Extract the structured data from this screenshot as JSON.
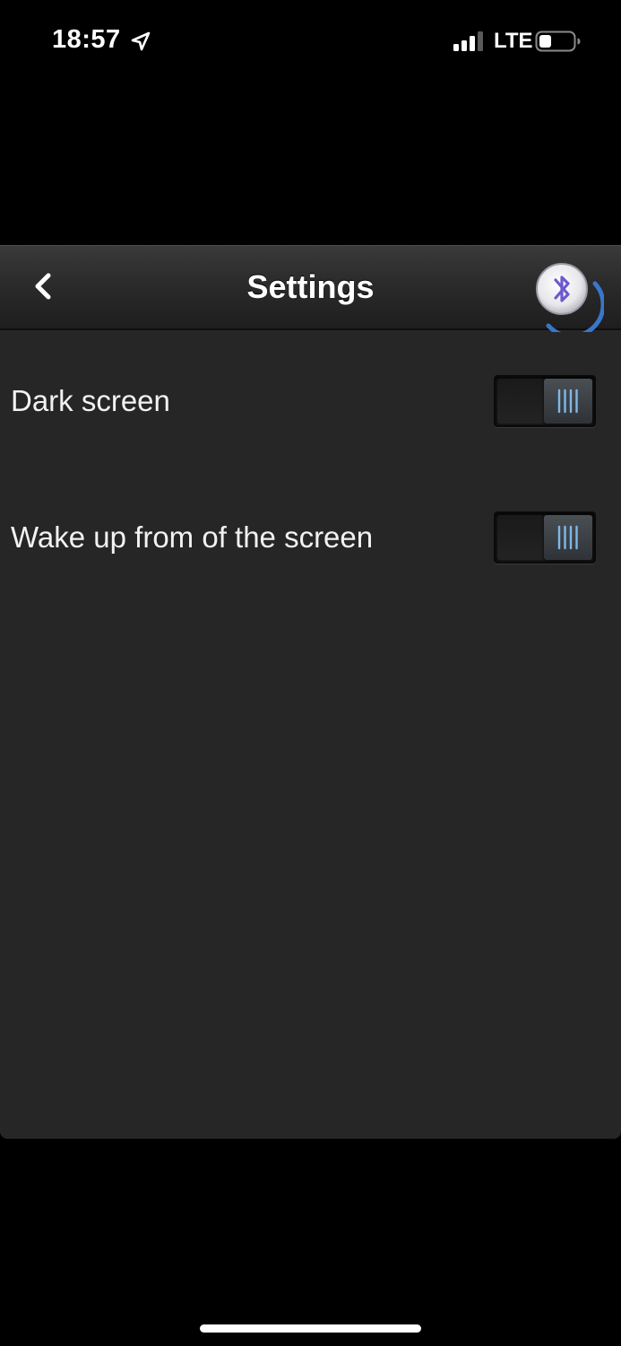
{
  "status_bar": {
    "time": "18:57",
    "network": "LTE",
    "icons": [
      "location-arrow-icon",
      "cellular-signal-icon",
      "battery-icon"
    ]
  },
  "nav": {
    "title": "Settings",
    "back_icon": "chevron-left-icon",
    "bluetooth_icon": "bluetooth-icon"
  },
  "settings": {
    "items": [
      {
        "label": "Dark screen",
        "state": "on"
      },
      {
        "label": "Wake up from of the screen",
        "state": "on"
      }
    ]
  },
  "colors": {
    "panel_background": "#262626",
    "toggle_accent": "#7fb8e6",
    "bluetooth_accent": "#3a7bd5",
    "bluetooth_glyph": "#6a5acd"
  }
}
